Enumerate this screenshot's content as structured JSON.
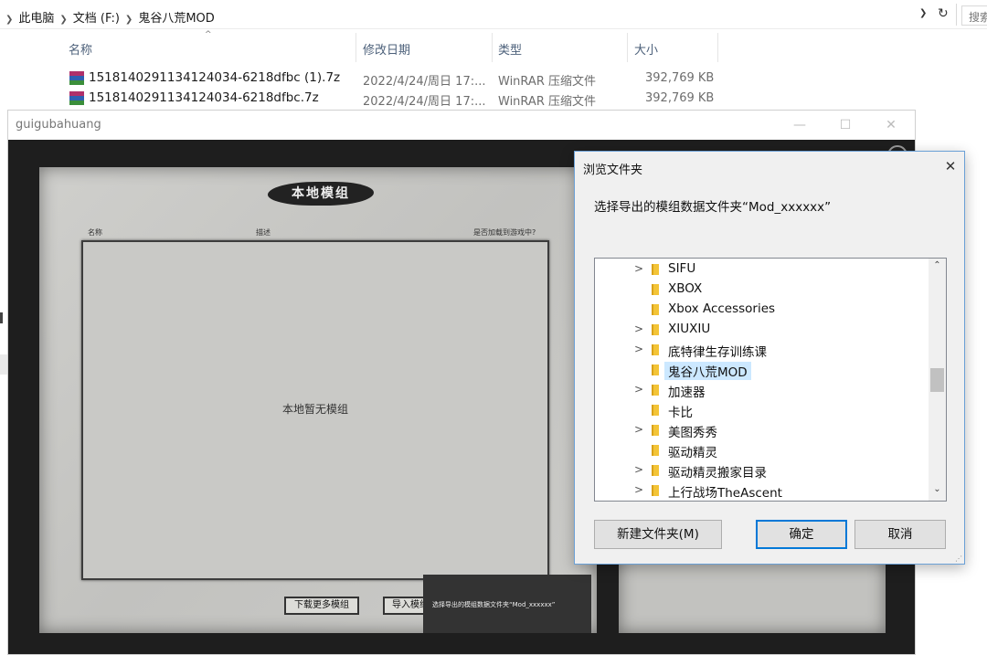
{
  "explorer": {
    "breadcrumbs": [
      "此电脑",
      "文档 (F:)",
      "鬼谷八荒MOD"
    ],
    "search_placeholder": "搜索",
    "columns": [
      "名称",
      "修改日期",
      "类型",
      "大小"
    ],
    "files": [
      {
        "name": "1518140291134124034-6218dfbc (1).7z",
        "date": "2022/4/24/周日 17:...",
        "type": "WinRAR 压缩文件",
        "size": "392,769 KB"
      },
      {
        "name": "1518140291134124034-6218dfbc.7z",
        "date": "2022/4/24/周日 17:...",
        "type": "WinRAR 压缩文件",
        "size": "392,769 KB"
      }
    ]
  },
  "game_window": {
    "title": "guigubahuang",
    "panel_title": "本地模组",
    "headers": [
      "名称",
      "描述",
      "是否加载到游戏中?"
    ],
    "empty_message": "本地暂无模组",
    "download_button": "下载更多模组",
    "import_button": "导入模组",
    "tooltip": "选择导出的模组数据文件夹“Mod_xxxxxx”"
  },
  "dialog": {
    "title": "浏览文件夹",
    "description": "选择导出的模组数据文件夹“Mod_xxxxxx”",
    "folders": [
      {
        "label": "SIFU",
        "expandable": true
      },
      {
        "label": "XBOX",
        "expandable": false
      },
      {
        "label": "Xbox Accessories",
        "expandable": false
      },
      {
        "label": "XIUXIU",
        "expandable": true
      },
      {
        "label": "底特律生存训练课",
        "expandable": true
      },
      {
        "label": "鬼谷八荒MOD",
        "expandable": false,
        "selected": true
      },
      {
        "label": "加速器",
        "expandable": true
      },
      {
        "label": "卡比",
        "expandable": false
      },
      {
        "label": "美图秀秀",
        "expandable": true
      },
      {
        "label": "驱动精灵",
        "expandable": false
      },
      {
        "label": "驱动精灵搬家目录",
        "expandable": true
      },
      {
        "label": "上行战场TheAscent",
        "expandable": true
      }
    ],
    "new_folder_button": "新建文件夹(M)",
    "ok_button": "确定",
    "cancel_button": "取消"
  }
}
